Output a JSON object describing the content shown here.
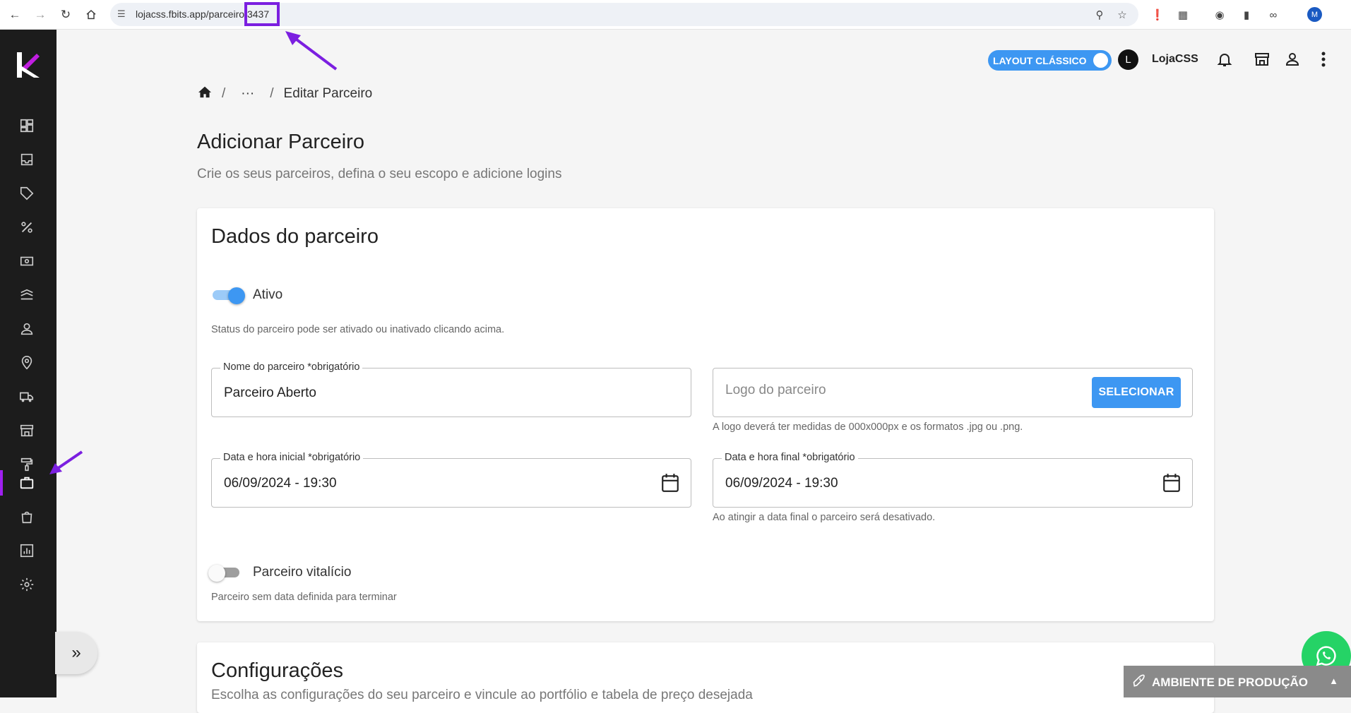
{
  "browser": {
    "url_prefix": "lojacss.fbits.app/parceiro",
    "url_id": "/3437",
    "profile_initial": "M"
  },
  "topbar": {
    "layout_label": "LAYOUT CLÁSSICO",
    "avatar_initial": "L",
    "store_name": "LojaCSS"
  },
  "breadcrumb": {
    "sep": "/",
    "ellipsis": "···",
    "current": "Editar Parceiro"
  },
  "page": {
    "title": "Adicionar Parceiro",
    "subtitle": "Crie os seus parceiros, defina o seu escopo e adicione logins"
  },
  "card": {
    "title": "Dados do parceiro",
    "active_label": "Ativo",
    "active_on": true,
    "active_help": "Status do parceiro pode ser ativado ou inativado clicando acima.",
    "name_legend": "Nome do parceiro *obrigatório",
    "name_value": "Parceiro Aberto",
    "logo_placeholder": "Logo do parceiro",
    "logo_button": "SELECIONAR",
    "logo_help": "A logo deverá ter medidas de 000x000px e os formatos .jpg ou .png.",
    "start_legend": "Data e hora inicial *obrigatório",
    "start_value": "06/09/2024 - 19:30",
    "end_legend": "Data e hora final *obrigatório",
    "end_value": "06/09/2024 - 19:30",
    "end_help": "Ao atingir a data final o parceiro será desativado.",
    "lifetime_label": "Parceiro vitalício",
    "lifetime_on": false,
    "lifetime_help": "Parceiro sem data definida para terminar"
  },
  "config": {
    "title": "Configurações",
    "subtitle": "Escolha as configurações do seu parceiro e vincule ao portfólio e tabela de preço desejada"
  },
  "env": {
    "label": "AMBIENTE DE PRODUÇÃO"
  },
  "colors": {
    "accent": "#3d97f2",
    "annotation": "#7b1fe0",
    "sidebar": "#1c1c1c"
  }
}
